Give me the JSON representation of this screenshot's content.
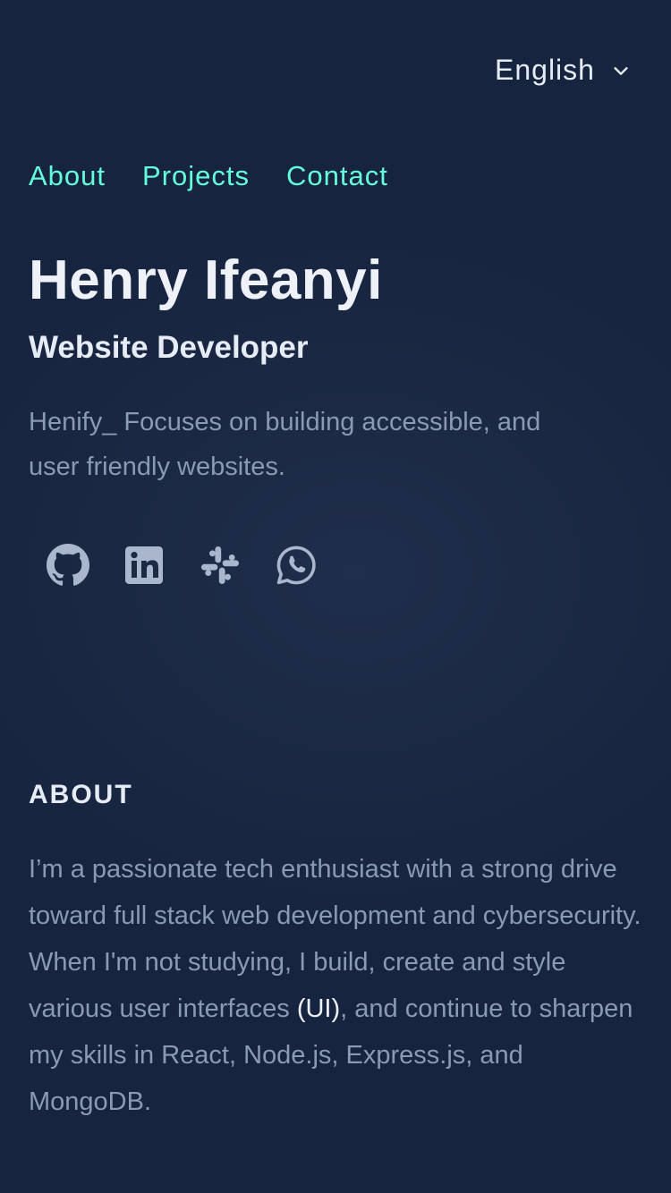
{
  "language_selector": {
    "label": "English",
    "icon": "chevron-down-icon"
  },
  "nav": {
    "items": [
      {
        "label": "About"
      },
      {
        "label": "Projects"
      },
      {
        "label": "Contact"
      }
    ]
  },
  "hero": {
    "name": "Henry Ifeanyi",
    "role": "Website Developer",
    "tagline": "Henify_ Focuses on building accessible, and user friendly websites."
  },
  "socials": [
    {
      "icon": "github-icon"
    },
    {
      "icon": "linkedin-icon"
    },
    {
      "icon": "slack-icon"
    },
    {
      "icon": "whatsapp-icon"
    }
  ],
  "about": {
    "title": "ABOUT",
    "text_before": "I’m a passionate tech enthusiast with a strong drive toward full stack web development and cybersecurity. When I'm not studying, I build, create and style various user interfaces ",
    "highlight": "(UI)",
    "text_after": ", and continue to sharpen my skills in React, Node.js, Express.js, and MongoDB."
  },
  "colors": {
    "background": "#1a2843",
    "accent": "#64ffda",
    "heading": "#eef2f8",
    "muted_text": "#8a99b4",
    "icon": "#a9b6cc"
  }
}
